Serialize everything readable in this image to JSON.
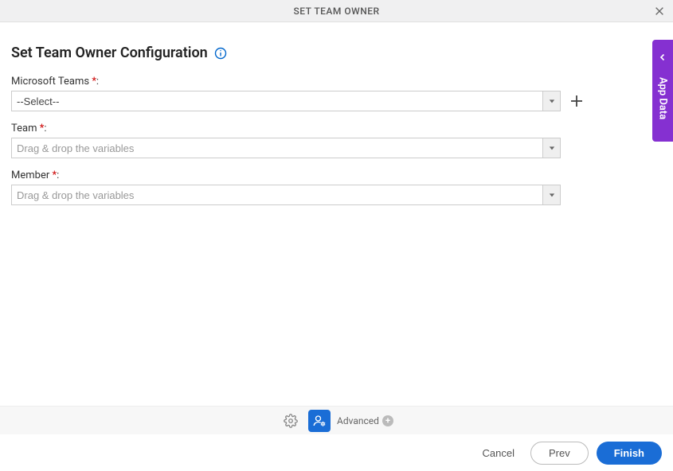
{
  "header": {
    "title": "SET TEAM OWNER"
  },
  "page": {
    "title": "Set Team Owner Configuration"
  },
  "form": {
    "microsoft_teams": {
      "label": "Microsoft Teams",
      "required": "*",
      "value": "--Select--"
    },
    "team": {
      "label": "Team",
      "required": "*",
      "placeholder": "Drag & drop the variables"
    },
    "member": {
      "label": "Member",
      "required": "*",
      "placeholder": "Drag & drop the variables"
    }
  },
  "side_tab": {
    "label": "App Data"
  },
  "toolbar": {
    "advanced": "Advanced"
  },
  "footer": {
    "cancel": "Cancel",
    "prev": "Prev",
    "finish": "Finish"
  }
}
